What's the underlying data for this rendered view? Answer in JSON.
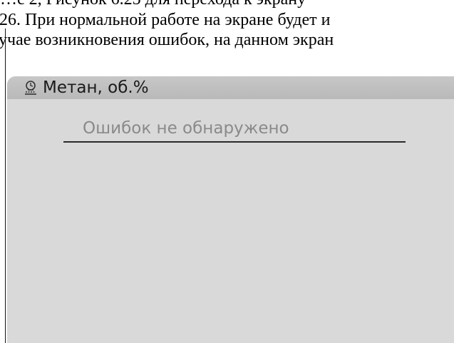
{
  "document": {
    "lines": [
      "…с 2, Рисунок 6.25 для перехода к экрану",
      "26. При нормальной работе на экране будет и",
      "учае возникновения ошибок, на данном экран"
    ]
  },
  "screen": {
    "title": "Метан, об.%",
    "status_message": "Ошибок не обнаружено",
    "icon": "gas-sensor-icon",
    "colors": {
      "background": "#d9d9d9",
      "header": "#bfbfbf",
      "message_text": "#8a8a8a"
    }
  }
}
